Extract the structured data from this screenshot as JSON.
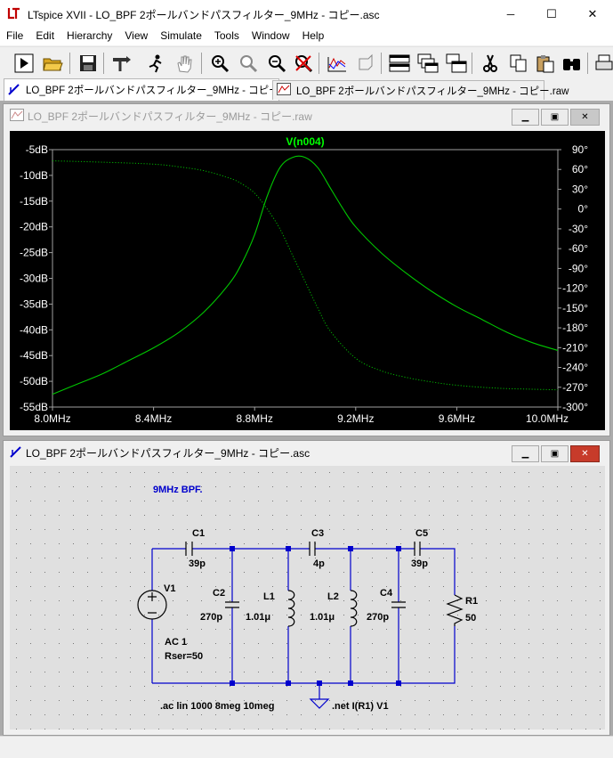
{
  "app": {
    "title": "LTspice XVII - LO_BPF 2ポールバンドパスフィルター_9MHz - コピー.asc",
    "icon": "ltspice-logo-icon"
  },
  "window_controls": {
    "minimize": "─",
    "maximize": "☐",
    "close": "✕"
  },
  "menu": [
    "File",
    "Edit",
    "Hierarchy",
    "View",
    "Simulate",
    "Tools",
    "Window",
    "Help"
  ],
  "toolbar": [
    "run-icon",
    "open-icon",
    "save-icon",
    "control-panel-icon",
    "run-probe-icon",
    "pan-hand-icon",
    "zoom-in-icon",
    "zoom-full-icon",
    "zoom-out-icon",
    "zoom-cancel-icon",
    "waveform-icon",
    "ltspice-3d-icon",
    "tile-horizontal-icon",
    "cascade-icon",
    "tile-vertical-icon",
    "cut-icon",
    "copy-icon",
    "paste-icon",
    "find-icon",
    "print-icon"
  ],
  "tabs": [
    {
      "label": "LO_BPF 2ポールバンドパスフィルター_9MHz  - コピー.asc",
      "icon": "schematic-icon",
      "active": true
    },
    {
      "label": "LO_BPF 2ポールバンドパスフィルター_9MHz  - コピー.raw",
      "icon": "waveform-icon",
      "active": false
    }
  ],
  "plot_window": {
    "title": "LO_BPF 2ポールバンドパスフィルター_9MHz  - コピー.raw",
    "colors": {
      "background": "#000000",
      "trace": "#00c800",
      "axis_text": "#ffffff",
      "trace_label": "#00ff00"
    }
  },
  "schematic_window": {
    "title": "LO_BPF 2ポールバンドパスフィルター_9MHz  - コピー.asc",
    "comment": "9MHz BPF.",
    "colors": {
      "wire": "#0000cd",
      "text": "#000000",
      "comment": "#0000cd",
      "background": "#e0e0e0"
    },
    "components": [
      {
        "ref": "C1",
        "value": "39p"
      },
      {
        "ref": "C3",
        "value": "4p"
      },
      {
        "ref": "C5",
        "value": "39p"
      },
      {
        "ref": "V1",
        "value": "AC 1",
        "extra": "Rser=50"
      },
      {
        "ref": "C2",
        "value": "270p"
      },
      {
        "ref": "L1",
        "value": "1.01μ"
      },
      {
        "ref": "L2",
        "value": "1.01μ"
      },
      {
        "ref": "C4",
        "value": "270p"
      },
      {
        "ref": "R1",
        "value": "50"
      }
    ],
    "directives": [
      ".ac lin 1000 8meg 10meg",
      ".net I(R1) V1"
    ]
  },
  "chart_data": {
    "type": "line",
    "title": "V(n004)",
    "xlabel": "",
    "ylabel": "",
    "xlim": [
      8.0,
      10.0
    ],
    "ylim": [
      -55,
      -5
    ],
    "y2lim": [
      -300,
      90
    ],
    "x_ticks": [
      "8.0MHz",
      "8.4MHz",
      "8.8MHz",
      "9.2MHz",
      "9.6MHz",
      "10.0MHz"
    ],
    "y_ticks": [
      "-5dB",
      "-10dB",
      "-15dB",
      "-20dB",
      "-25dB",
      "-30dB",
      "-35dB",
      "-40dB",
      "-45dB",
      "-50dB",
      "-55dB"
    ],
    "y2_ticks": [
      "90°",
      "60°",
      "30°",
      "0°",
      "-30°",
      "-60°",
      "-90°",
      "-120°",
      "-150°",
      "-180°",
      "-210°",
      "-240°",
      "-270°",
      "-300°"
    ],
    "grid": false,
    "series": [
      {
        "name": "V(n004)",
        "style": "solid",
        "axis": "left-dB",
        "x": [
          8.0,
          8.1,
          8.2,
          8.3,
          8.4,
          8.5,
          8.6,
          8.7,
          8.75,
          8.8,
          8.85,
          8.9,
          8.95,
          9.0,
          9.05,
          9.1,
          9.15,
          9.2,
          9.3,
          9.4,
          9.5,
          9.6,
          9.7,
          9.8,
          9.9,
          10.0
        ],
        "y": [
          -52.5,
          -50.5,
          -48.5,
          -46.0,
          -43.5,
          -40.5,
          -36.5,
          -31.0,
          -27.0,
          -21.5,
          -14.0,
          -8.5,
          -6.5,
          -6.5,
          -8.5,
          -12.5,
          -16.5,
          -20.0,
          -25.0,
          -29.0,
          -32.5,
          -35.5,
          -38.0,
          -40.5,
          -42.5,
          -44.0
        ]
      },
      {
        "name": "phase",
        "style": "dotted",
        "axis": "right-deg",
        "x": [
          8.0,
          8.2,
          8.4,
          8.5,
          8.6,
          8.7,
          8.75,
          8.8,
          8.85,
          8.9,
          8.95,
          9.0,
          9.05,
          9.1,
          9.2,
          9.3,
          9.4,
          9.5,
          9.6,
          9.7,
          9.8,
          9.9,
          10.0
        ],
        "y": [
          73,
          71,
          68,
          64,
          58,
          47,
          38,
          24,
          0,
          -30,
          -70,
          -110,
          -150,
          -185,
          -226,
          -245,
          -255,
          -262,
          -267,
          -270,
          -272,
          -273,
          -274
        ]
      }
    ]
  }
}
